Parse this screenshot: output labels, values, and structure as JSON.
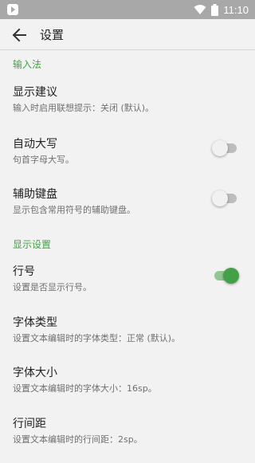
{
  "status_bar": {
    "time": "11:10",
    "icons": [
      "app-notification-icon",
      "wifi-icon",
      "battery-icon"
    ]
  },
  "app_bar": {
    "title": "设置",
    "back_icon": "arrow-left-icon"
  },
  "sections": [
    {
      "header": "输入法",
      "items": [
        {
          "title": "显示建议",
          "summary": "输入时启用联想提示：关闭 (默认)。",
          "switch": null
        },
        {
          "title": "自动大写",
          "summary": "句首字母大写。",
          "switch": false
        },
        {
          "title": "辅助键盘",
          "summary": "显示包含常用符号的辅助键盘。",
          "switch": false
        }
      ]
    },
    {
      "header": "显示设置",
      "items": [
        {
          "title": "行号",
          "summary": "设置是否显示行号。",
          "switch": true
        },
        {
          "title": "字体类型",
          "summary": "设置文本编辑时的字体类型：正常 (默认)。",
          "switch": null
        },
        {
          "title": "字体大小",
          "summary": "设置文本编辑时的字体大小：16sp。",
          "switch": null
        },
        {
          "title": "行间距",
          "summary": "设置文本编辑时的行间距：2sp。",
          "switch": null
        }
      ]
    }
  ],
  "colors": {
    "accent": "#43a047",
    "status_bar": "#a8a8a8",
    "background": "#f2f2f2"
  }
}
